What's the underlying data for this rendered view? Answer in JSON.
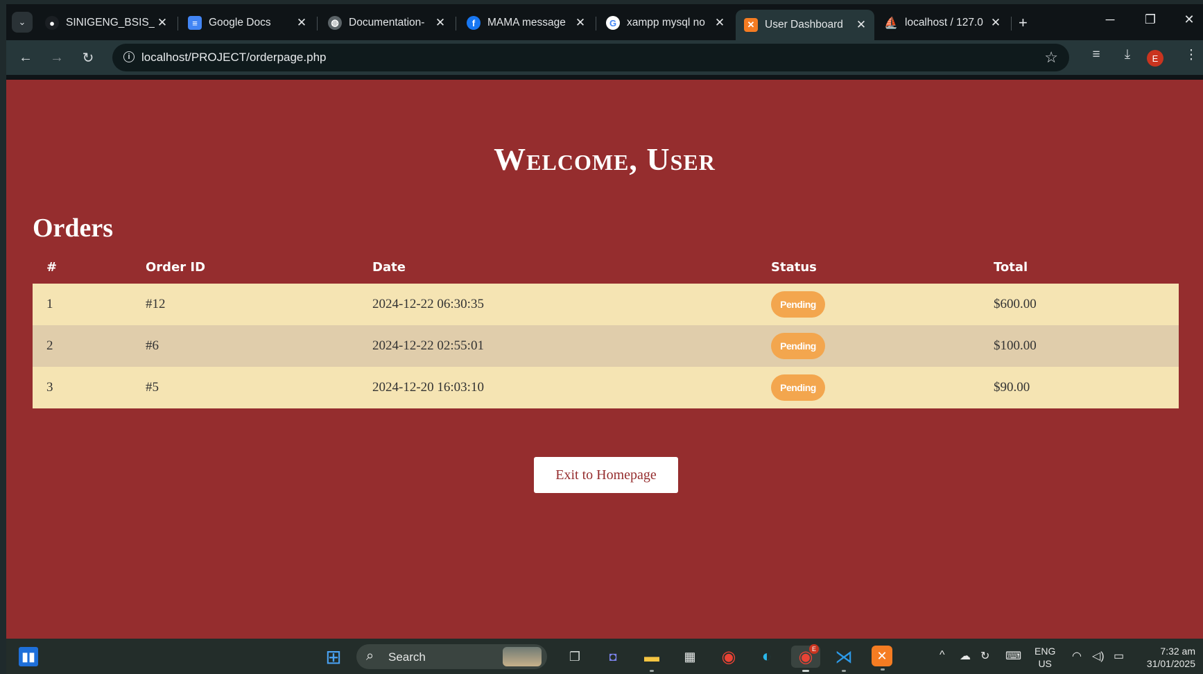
{
  "browser": {
    "tabs": [
      {
        "title": "SINIGENG_BSIS_",
        "icon": "github-icon",
        "fav_glyph": "●",
        "fav_color": "#1b1f23"
      },
      {
        "title": "Google Docs",
        "icon": "google-docs-icon",
        "fav_glyph": "≡",
        "fav_color": "#4285f4"
      },
      {
        "title": "Documentation-",
        "icon": "globe-icon",
        "fav_glyph": "◍",
        "fav_color": "#5c6468"
      },
      {
        "title": "MAMA message",
        "icon": "facebook-icon",
        "fav_glyph": "f",
        "fav_color": "#1877f2"
      },
      {
        "title": "xampp mysql no",
        "icon": "google-icon",
        "fav_glyph": "G",
        "fav_color": "#ffffff"
      },
      {
        "title": "User Dashboard",
        "icon": "xampp-icon",
        "fav_glyph": "✕",
        "fav_color": "#f57c22"
      },
      {
        "title": "localhost / 127.0",
        "icon": "phpmyadmin-icon",
        "fav_glyph": "⛵",
        "fav_color": "#f5a623"
      }
    ],
    "url": "localhost/PROJECT/orderpage.php",
    "profile_initial": "E"
  },
  "page": {
    "welcome": "Welcome, User",
    "orders_title": "Orders",
    "columns": [
      "#",
      "Order ID",
      "Date",
      "Status",
      "Total"
    ],
    "rows": [
      {
        "num": "1",
        "order_id": "#12",
        "date": "2024-12-22 06:30:35",
        "status": "Pending",
        "total": "$600.00"
      },
      {
        "num": "2",
        "order_id": "#6",
        "date": "2024-12-22 02:55:01",
        "status": "Pending",
        "total": "$100.00"
      },
      {
        "num": "3",
        "order_id": "#5",
        "date": "2024-12-20 16:03:10",
        "status": "Pending",
        "total": "$90.00"
      }
    ],
    "exit_button": "Exit to Homepage"
  },
  "taskbar": {
    "search_label": "Search",
    "lang_line1": "ENG",
    "lang_line2": "US",
    "time": "7:32 am",
    "date": "31/01/2025",
    "chrome_badge": "E"
  },
  "colors": {
    "page_bg": "#952d2e",
    "row_odd": "#f5e4b3",
    "row_even": "#e0cdab",
    "badge": "#f3a64e"
  }
}
